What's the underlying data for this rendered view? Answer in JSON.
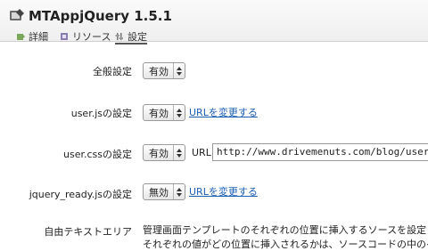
{
  "plugin": {
    "title": "MTAppjQuery 1.5.1"
  },
  "tabs": [
    {
      "label": "詳細",
      "active": false
    },
    {
      "label": "リソース",
      "active": false
    },
    {
      "label": "設定",
      "active": true
    }
  ],
  "settings": {
    "general": {
      "label": "全般設定",
      "value": "有効"
    },
    "userjs": {
      "label": "user.jsの設定",
      "value": "有効",
      "link": "URLを変更する"
    },
    "usercss": {
      "label": "user.cssの設定",
      "value": "有効",
      "url_label": "URL",
      "url_value": "http://www.drivemenuts.com/blog/user.css"
    },
    "jquery_ready": {
      "label": "jquery_ready.jsの設定",
      "value": "無効",
      "link": "URLを変更する"
    },
    "free_text": {
      "label": "自由テキストエリア",
      "desc_line1": "管理画面テンプレートのそれぞれの位置に挿入するソースを設定し",
      "desc_line2": "それぞれの値がどの位置に挿入されるかは、ソースコードの中の<!"
    }
  },
  "colors": {
    "link": "#1a5fb4",
    "header_bg": "#efefef"
  }
}
